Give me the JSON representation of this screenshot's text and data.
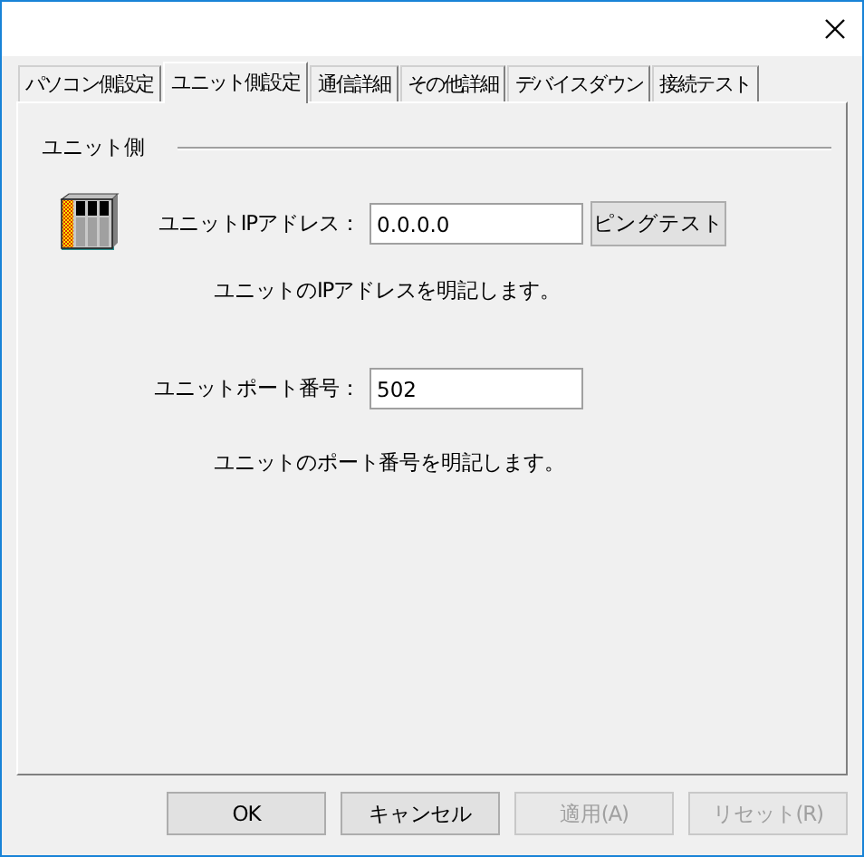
{
  "tabs": [
    {
      "label": "パソコン側設定",
      "selected": false
    },
    {
      "label": "ユニット側設定",
      "selected": true
    },
    {
      "label": "通信詳細",
      "selected": false
    },
    {
      "label": "その他詳細",
      "selected": false
    },
    {
      "label": "デバイスダウン",
      "selected": false
    },
    {
      "label": "接続テスト",
      "selected": false
    }
  ],
  "group": {
    "title": "ユニット側"
  },
  "fields": [
    {
      "label": "ユニットIPアドレス：",
      "value": "0.0.0.0",
      "button": "ピングテスト",
      "description": "ユニットのIPアドレスを明記します。"
    },
    {
      "label": "ユニットポート番号：",
      "value": "502",
      "description": "ユニットのポート番号を明記します。"
    }
  ],
  "buttons": [
    {
      "label": "OK",
      "disabled": false
    },
    {
      "label": "キャンセル",
      "disabled": false
    },
    {
      "label": "適用(A)",
      "disabled": true
    },
    {
      "label": "リセット(R)",
      "disabled": true
    }
  ]
}
